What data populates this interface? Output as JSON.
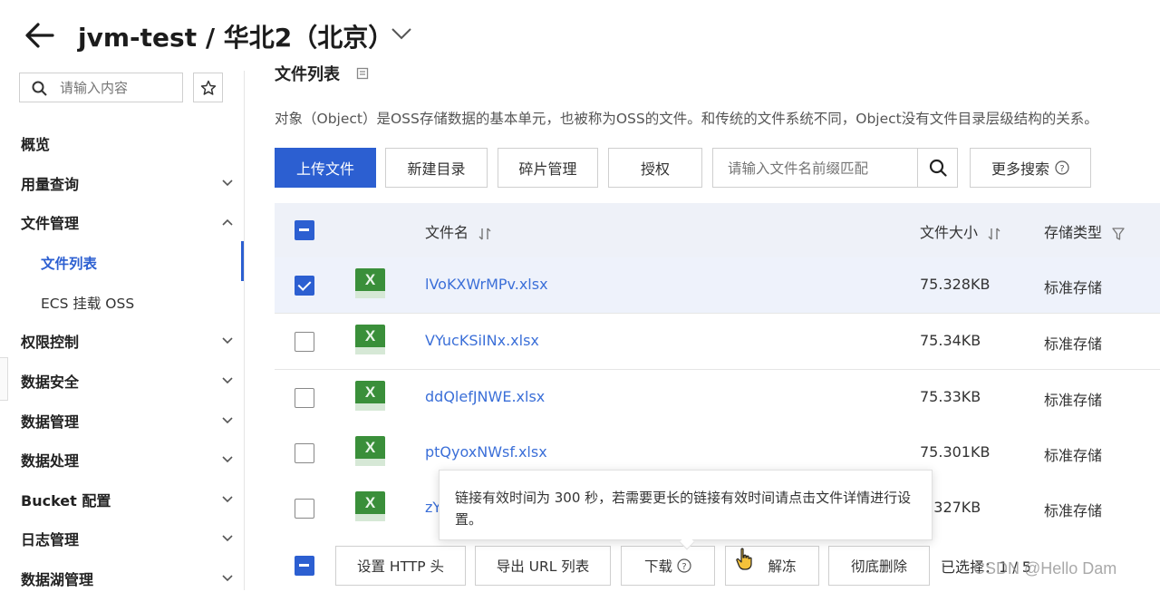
{
  "header": {
    "title": "jvm-test / 华北2（北京）"
  },
  "sidebar": {
    "search_placeholder": "请输入内容",
    "items": [
      {
        "label": "概览"
      },
      {
        "label": "用量查询"
      },
      {
        "label": "文件管理"
      },
      {
        "label": "文件列表"
      },
      {
        "label": "ECS 挂载 OSS"
      },
      {
        "label": "权限控制"
      },
      {
        "label": "数据安全"
      },
      {
        "label": "数据管理"
      },
      {
        "label": "数据处理"
      },
      {
        "label": "Bucket 配置"
      },
      {
        "label": "日志管理"
      },
      {
        "label": "数据湖管理"
      }
    ]
  },
  "main": {
    "section_title": "文件列表",
    "description": "对象（Object）是OSS存储数据的基本单元，也被称为OSS的文件。和传统的文件系统不同，Object没有文件目录层级结构的关系。",
    "toolbar": {
      "upload": "上传文件",
      "new_dir": "新建目录",
      "fragments": "碎片管理",
      "authorize": "授权",
      "search_placeholder": "请输入文件名前缀匹配",
      "more_search": "更多搜索"
    },
    "table": {
      "headers": {
        "name": "文件名",
        "size": "文件大小",
        "type": "存储类型"
      },
      "rows": [
        {
          "name": "lVoKXWrMPv.xlsx",
          "size": "75.328KB",
          "type": "标准存储",
          "checked": true
        },
        {
          "name": "VYucKSiINx.xlsx",
          "size": "75.34KB",
          "type": "标准存储",
          "checked": false
        },
        {
          "name": "ddQlefJNWE.xlsx",
          "size": "75.33KB",
          "type": "标准存储",
          "checked": false
        },
        {
          "name": "ptQyoxNWsf.xlsx",
          "size": "75.301KB",
          "type": "标准存储",
          "checked": false
        },
        {
          "name": "zY",
          "size": "5.327KB",
          "type": "标准存储",
          "checked": false
        }
      ]
    },
    "tooltip": "链接有效时间为 300 秒，若需要更长的链接有效时间请点击文件详情进行设置。",
    "bottom_bar": {
      "set_http_header": "设置 HTTP 头",
      "export_url": "导出 URL 列表",
      "download": "下载",
      "unfreeze": "解冻",
      "delete": "彻底删除",
      "selected": "已选择：1 / 5"
    }
  },
  "watermark": "CSDN @Hello Dam",
  "colors": {
    "primary": "#2c5fd1",
    "link": "#3b6fd8",
    "excel_green": "#3a8f3a"
  }
}
